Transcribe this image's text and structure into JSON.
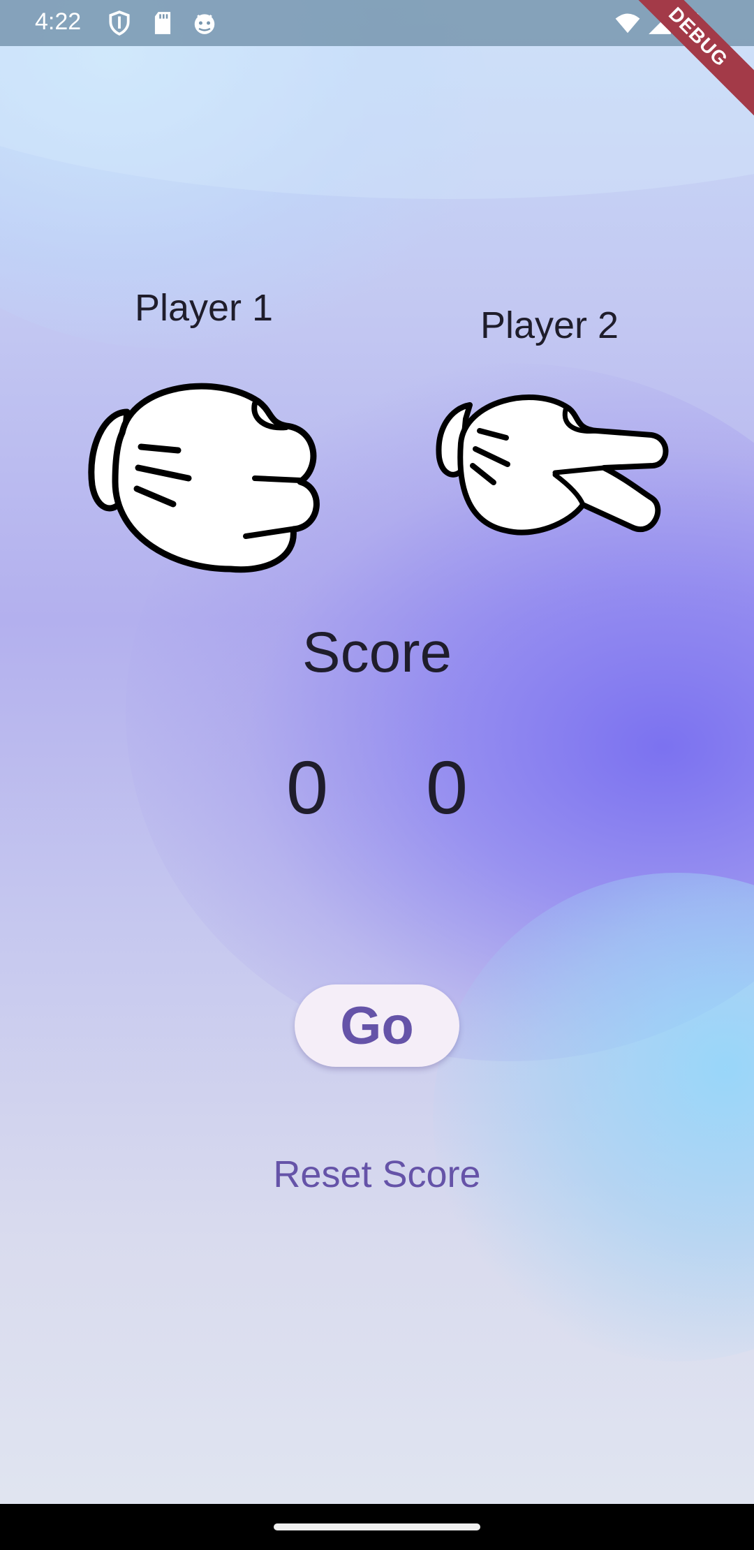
{
  "status_bar": {
    "time": "4:22",
    "icons": [
      "shield-icon",
      "sd-card-icon",
      "android-debug-icon",
      "wifi-icon",
      "cellular-signal-icon",
      "battery-icon"
    ]
  },
  "debug_banner": "DEBUG",
  "players": {
    "player1": {
      "label": "Player 1",
      "hand": "rock"
    },
    "player2": {
      "label": "Player 2",
      "hand": "scissors"
    }
  },
  "score": {
    "title": "Score",
    "player1": "0",
    "player2": "0"
  },
  "actions": {
    "go_label": "Go",
    "reset_label": "Reset Score"
  },
  "colors": {
    "accent": "#6553a8",
    "text": "#1f1d2b",
    "button_bg": "#f5eef8",
    "debug_banner": "#a33a48"
  }
}
